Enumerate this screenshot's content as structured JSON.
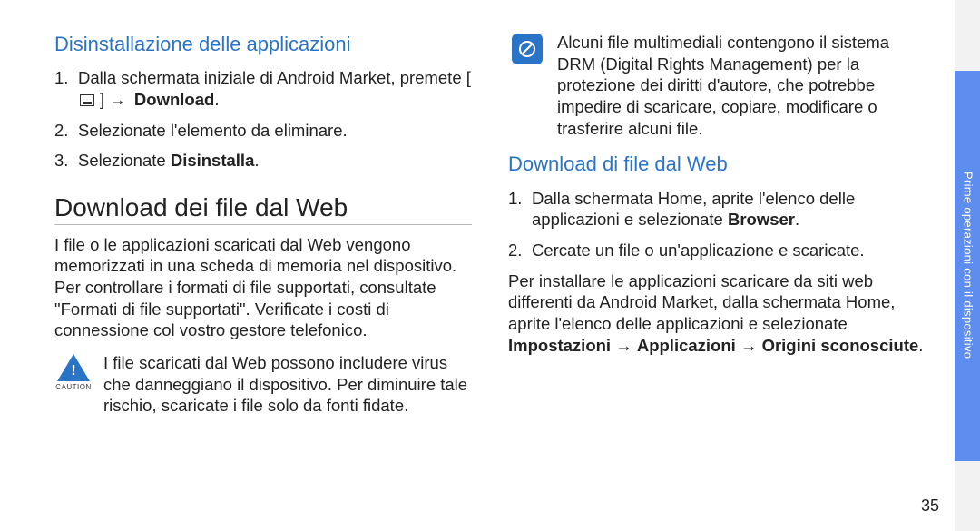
{
  "left": {
    "heading_uninstall": "Disinstallazione delle applicazioni",
    "steps_uninstall": {
      "s1_a": "Dalla schermata iniziale di Android Market, premete [",
      "s1_arrow": "] → ",
      "s1_bold": "Download",
      "s1_end": ".",
      "s2": "Selezionate l'elemento da eliminare.",
      "s3_a": "Selezionate ",
      "s3_bold": "Disinstalla",
      "s3_end": "."
    },
    "heading_download": "Download dei file dal Web",
    "para_download": "I file o le applicazioni scaricati dal Web vengono memorizzati in una scheda di memoria nel dispositivo. Per controllare i formati di file supportati, consultate \"Formati di file supportati\". Verificate i costi di connessione col vostro gestore telefonico.",
    "caution_label": "CAUTION",
    "caution_text": "I file scaricati dal Web possono includere virus che danneggiano il dispositivo. Per diminuire tale rischio, scaricate i file solo da fonti fidate."
  },
  "right": {
    "note_text": "Alcuni file multimediali contengono il sistema DRM (Digital Rights Management) per la protezione dei diritti d'autore, che potrebbe impedire di scaricare, copiare, modificare o trasferire alcuni file.",
    "heading_download_web": "Download di file dal Web",
    "steps_download": {
      "s1_a": "Dalla schermata Home, aprite l'elenco delle applicazioni e selezionate ",
      "s1_bold": "Browser",
      "s1_end": ".",
      "s2": "Cercate un file o un'applicazione e scaricate."
    },
    "para_install_a": "Per installare le applicazioni scaricare da siti web differenti da Android Market, dalla schermata Home, aprite l'elenco delle applicazioni e selezionate ",
    "para_install_b1": "Impostazioni",
    "para_install_arr1": " → ",
    "para_install_b2": "Applicazioni",
    "para_install_arr2": " → ",
    "para_install_b3": "Origini sconosciute",
    "para_install_end": "."
  },
  "sidebar_label": "Prime operazioni con il dispositivo",
  "page_number": "35"
}
